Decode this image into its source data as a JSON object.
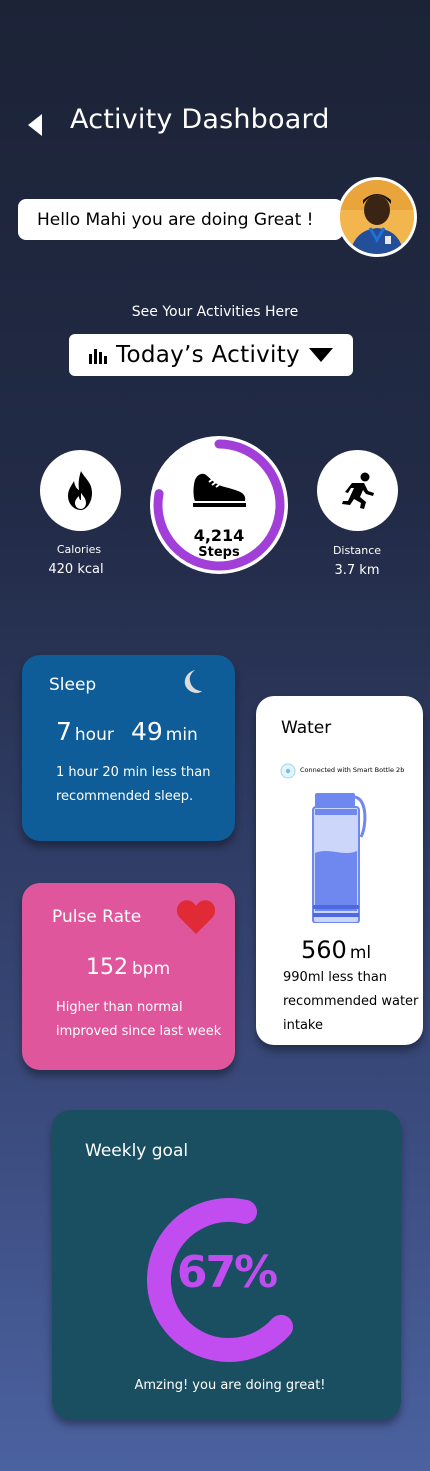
{
  "header": {
    "title": "Activity Dashboard"
  },
  "greeting": {
    "text": "Hello Mahi you are doing Great !"
  },
  "activity": {
    "section_label": "See Your Activities Here",
    "selector_label": "Todayʼs  Activity"
  },
  "stats": {
    "calories": {
      "label": "Calories",
      "value": "420 kcal",
      "icon": "flame-icon"
    },
    "steps": {
      "value": "4,214",
      "label": "Steps",
      "icon": "shoe-icon",
      "progress": 0.78,
      "color": "#a23fd8"
    },
    "distance": {
      "label": "Distance",
      "value": "3.7 km",
      "icon": "runner-icon"
    }
  },
  "sleep": {
    "title": "Sleep",
    "hours": "7",
    "hours_unit": "hour",
    "minutes": "49",
    "minutes_unit": "min",
    "note": "1 hour 20 min less than recommended sleep.",
    "color": "#0e5d98"
  },
  "pulse": {
    "title": "Pulse Rate",
    "value": "152",
    "unit": "bpm",
    "note": "Higher than normal improved since last week",
    "color": "#e0569d"
  },
  "water": {
    "title": "Water",
    "connection": "Connected with Smart Bottle 2b",
    "value": "560",
    "unit": "ml",
    "note": "990ml less than recommended water intake"
  },
  "weekly_goal": {
    "title": "Weekly goal",
    "percent_label": "67%",
    "progress": 0.67,
    "message": "Amzing! you are doing great!",
    "color": "#c14df0"
  }
}
